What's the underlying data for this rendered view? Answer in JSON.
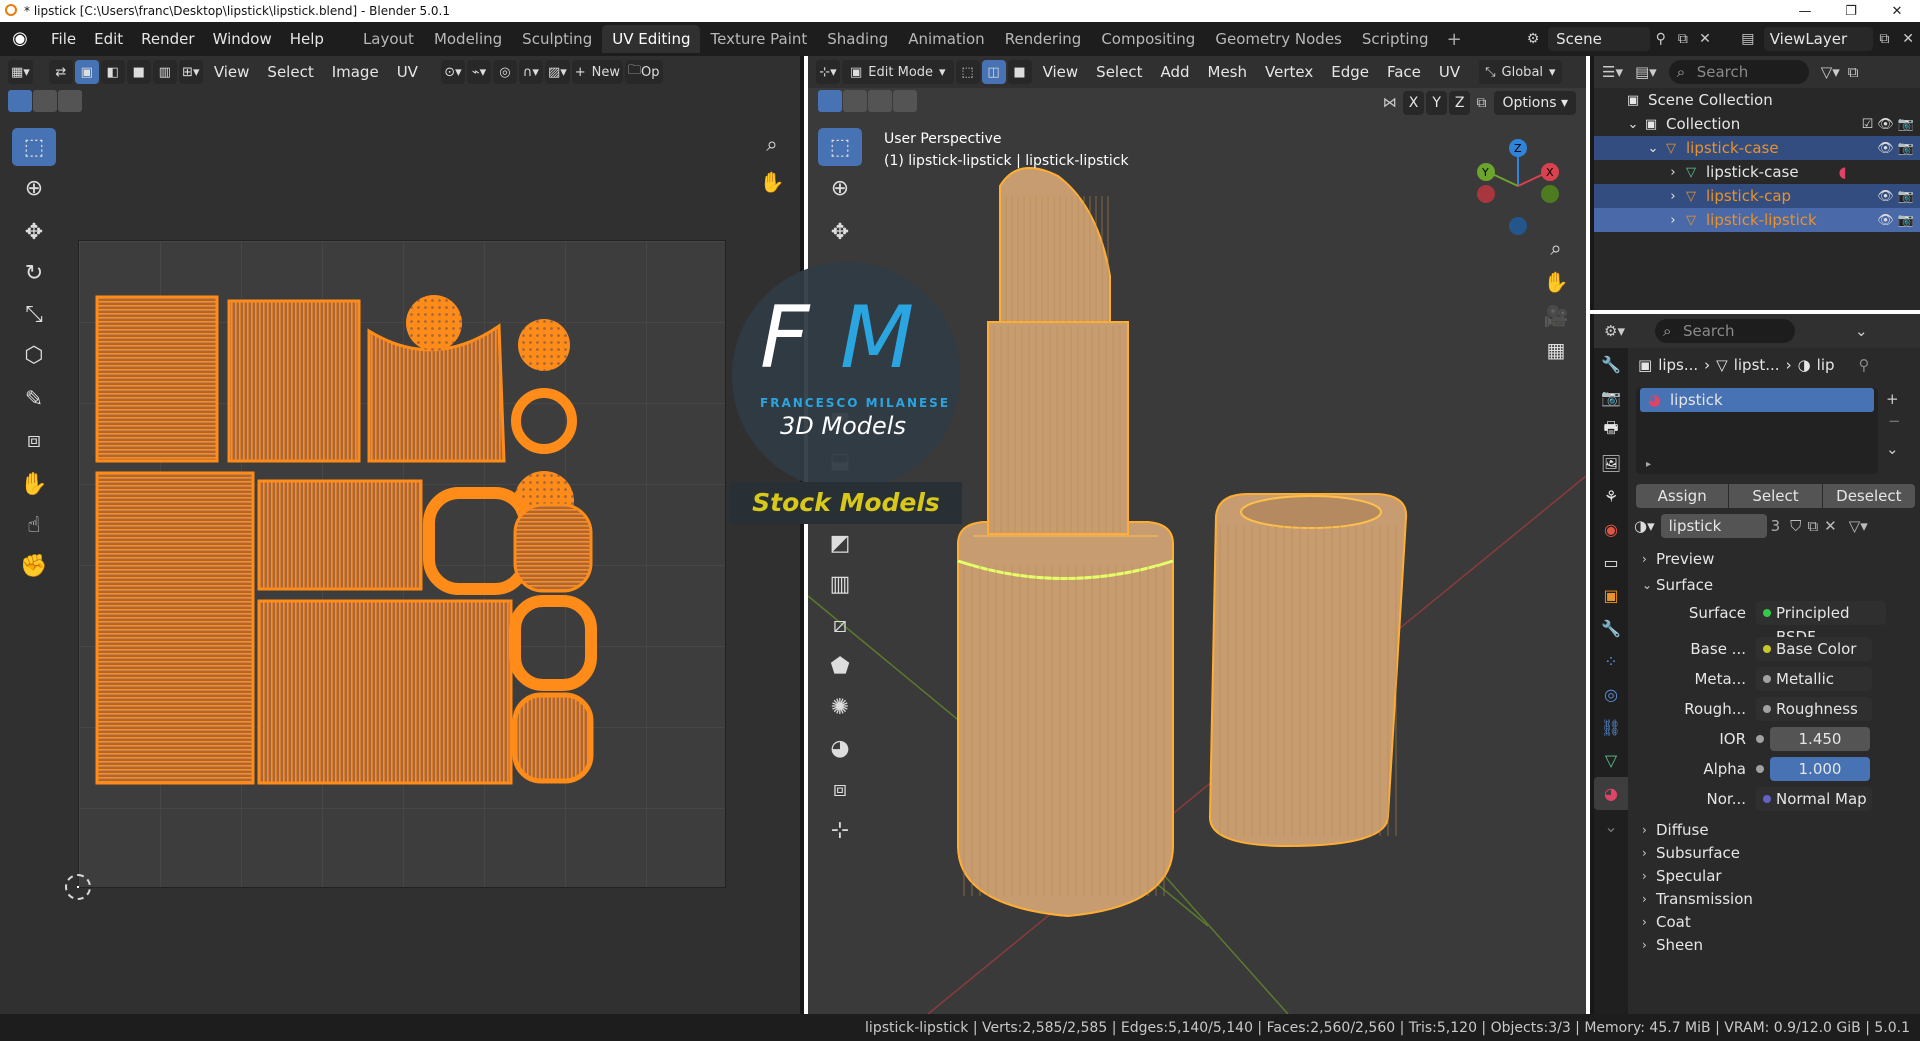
{
  "window": {
    "title": "* lipstick [C:\\Users\\franc\\Desktop\\lipstick\\lipstick.blend] - Blender 5.0.1"
  },
  "menu": [
    "File",
    "Edit",
    "Render",
    "Window",
    "Help"
  ],
  "workspaces": [
    "Layout",
    "Modeling",
    "Sculpting",
    "UV Editing",
    "Texture Paint",
    "Shading",
    "Animation",
    "Rendering",
    "Compositing",
    "Geometry Nodes",
    "Scripting"
  ],
  "active_workspace": "UV Editing",
  "scene": "Scene",
  "view_layer": "ViewLayer",
  "uv_editor": {
    "menus": [
      "View",
      "Select",
      "Image",
      "UV"
    ],
    "new_label": "New",
    "open_label": "Op"
  },
  "viewport": {
    "mode": "Edit Mode",
    "menus": [
      "View",
      "Select",
      "Add",
      "Mesh",
      "Vertex",
      "Edge",
      "Face",
      "UV"
    ],
    "orientation": "Global",
    "axes": [
      "X",
      "Y",
      "Z"
    ],
    "options_label": "Options",
    "perspective": "User Perspective",
    "object_info": "(1) lipstick-lipstick | lipstick-lipstick",
    "gizmo": {
      "z": "Z",
      "y": "Y",
      "x": "X"
    }
  },
  "watermark": {
    "logo_f": "F",
    "logo_m": "M",
    "name": "FRANCESCO MILANESE",
    "subtitle": "3D Models",
    "banner": "Stock Models"
  },
  "outliner": {
    "search_placeholder": "Search",
    "rows": [
      {
        "label": "Scene Collection",
        "indent": 0
      },
      {
        "label": "Collection",
        "indent": 1
      },
      {
        "label": "lipstick-case",
        "indent": 2,
        "selected": true,
        "orange": true
      },
      {
        "label": "lipstick-case",
        "indent": 3
      },
      {
        "label": "lipstick-cap",
        "indent": 3,
        "selected": true,
        "orange": true
      },
      {
        "label": "lipstick-lipstick",
        "indent": 3,
        "selected": true,
        "orange": true
      }
    ]
  },
  "properties": {
    "search_placeholder": "Search",
    "breadcrumb": [
      "lips...",
      "lipst...",
      "lip"
    ],
    "material_slot": "lipstick",
    "buttons": [
      "Assign",
      "Select",
      "Deselect"
    ],
    "material_name": "lipstick",
    "material_users": "3",
    "panels": {
      "preview": "Preview",
      "surface": "Surface"
    },
    "surface_label": "Surface",
    "surface_value": "Principled BSDF",
    "inputs": [
      {
        "label": "Base ...",
        "value": "Base Color",
        "dot": "#c7c729"
      },
      {
        "label": "Meta...",
        "value": "Metallic",
        "dot": "#a1a1a1"
      },
      {
        "label": "Rough...",
        "value": "Roughness",
        "dot": "#a1a1a1"
      },
      {
        "label": "IOR",
        "value": "1.450",
        "dot": "#a1a1a1"
      },
      {
        "label": "Alpha",
        "value": "1.000",
        "dot": "#a1a1a1"
      },
      {
        "label": "Nor...",
        "value": "Normal Map",
        "dot": "#6363c7"
      }
    ],
    "subpanels": [
      "Diffuse",
      "Subsurface",
      "Specular",
      "Transmission",
      "Coat",
      "Sheen"
    ]
  },
  "status": "lipstick-lipstick | Verts:2,585/2,585 | Edges:5,140/5,140 | Faces:2,560/2,560 | Tris:5,120 | Objects:3/3 | Memory: 45.7 MiB | VRAM: 0.9/12.0 GiB | 5.0.1",
  "colors": {
    "accent": "#4772b3",
    "uv_orange": "#ff8c19",
    "object_orange": "#e8922a",
    "lipstick_body": "#c79c70"
  }
}
